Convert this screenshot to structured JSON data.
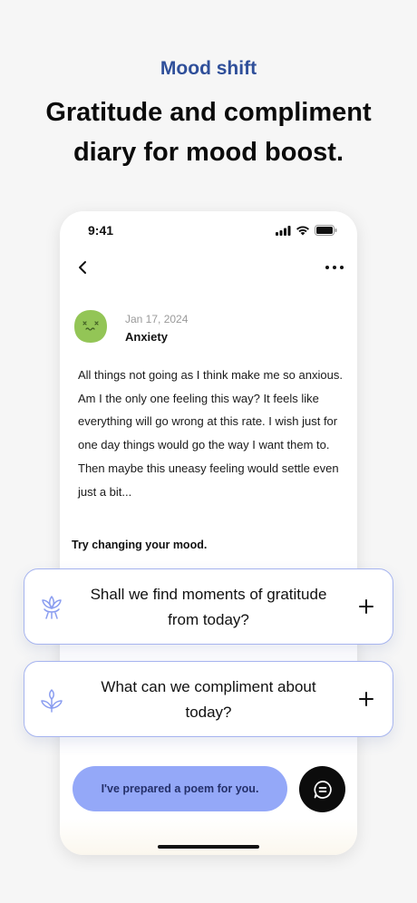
{
  "promo": {
    "eyebrow": "Mood shift",
    "headline": "Gratitude and compliment diary for mood boost."
  },
  "status_bar": {
    "time": "9:41"
  },
  "entry": {
    "date": "Jan 17, 2024",
    "mood": "Anxiety",
    "avatar_color": "#93c556",
    "body": "All things not going as I think make me so anxious. Am I the only one feeling this way? It feels like everything will go wrong at this rate. I wish just for one day things would go the way I want them to. Then maybe this uneasy feeling would settle even just a bit..."
  },
  "suggestions": {
    "label": "Try changing your mood.",
    "cards": [
      {
        "text": "Shall we find moments of gratitude from today?",
        "icon": "lotus-icon"
      },
      {
        "text": "What can we compliment about today?",
        "icon": "sprout-icon"
      }
    ]
  },
  "actions": {
    "poem_button": "I've prepared a poem for you.",
    "fab_icon": "chat-list-icon"
  },
  "colors": {
    "accent": "#2f4f9a",
    "card_border": "#a6b4ef",
    "poem_button": "#94a8f8",
    "fab": "#0c0c0c"
  }
}
